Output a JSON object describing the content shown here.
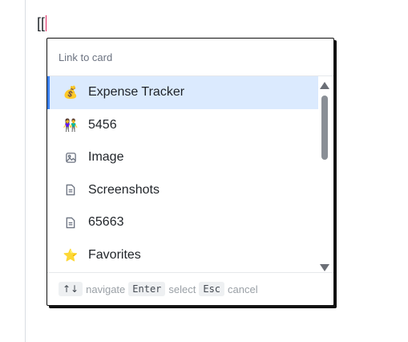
{
  "editor": {
    "text": "[["
  },
  "popup": {
    "header": "Link to card",
    "items": [
      {
        "label": "Expense Tracker",
        "icon": "money-bag-icon",
        "glyph": "💰",
        "selected": true
      },
      {
        "label": "5456",
        "icon": "people-icon",
        "glyph": "👫",
        "selected": false
      },
      {
        "label": "Image",
        "icon": "image-icon",
        "glyph": "",
        "selected": false
      },
      {
        "label": "Screenshots",
        "icon": "document-icon",
        "glyph": "",
        "selected": false
      },
      {
        "label": "65663",
        "icon": "document-icon",
        "glyph": "",
        "selected": false
      },
      {
        "label": "Favorites",
        "icon": "star-icon",
        "glyph": "⭐",
        "selected": false
      }
    ],
    "footer": {
      "navigate_key": "↑↓",
      "navigate_label": "navigate",
      "select_key": "Enter",
      "select_label": "select",
      "cancel_key": "Esc",
      "cancel_label": "cancel"
    }
  },
  "colors": {
    "selected_bg": "#dbeafe",
    "selected_accent": "#3b82f6",
    "caret": "#e0245e"
  }
}
